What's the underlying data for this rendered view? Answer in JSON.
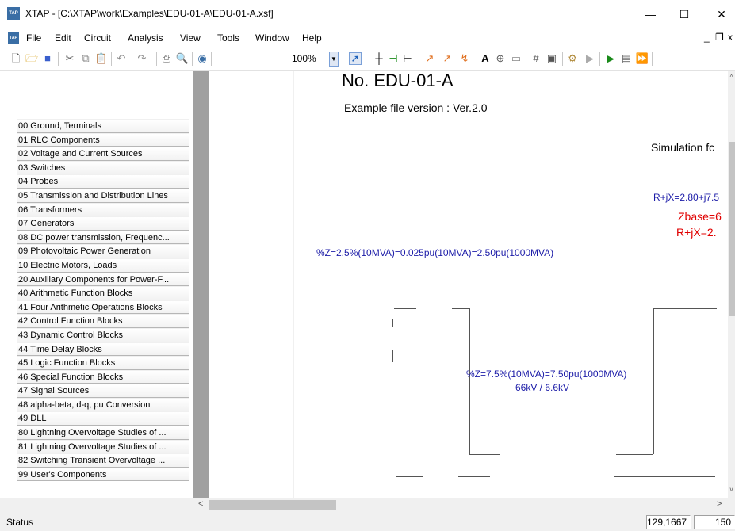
{
  "window": {
    "app_icon_text": "TAP",
    "title": "XTAP - [C:\\XTAP\\work\\Examples\\EDU-01-A\\EDU-01-A.xsf]",
    "minimize": "—",
    "maximize": "☐",
    "close": "✕"
  },
  "menubar": {
    "items": [
      "File",
      "Edit",
      "Circuit",
      "Analysis",
      "View",
      "Tools",
      "Window",
      "Help"
    ],
    "doc_min": "_",
    "doc_restore": "❐",
    "doc_close": "x"
  },
  "toolbar": {
    "zoom_value": "100%",
    "zoom_dropdown": "▼",
    "icons": [
      "new-file-icon",
      "open-folder-icon",
      "save-icon",
      "cut-icon",
      "copy-icon",
      "paste-icon",
      "undo-icon",
      "redo-icon",
      "print-icon",
      "print-preview-icon",
      "globe-icon",
      "pointer-icon",
      "wire-icon",
      "component-icon",
      "node-icon",
      "probe-icon",
      "arrow-icon",
      "junction-icon",
      "text-icon",
      "zoom-icon",
      "frame-icon",
      "grid-icon",
      "properties-icon",
      "settings-icon",
      "run-icon",
      "export-icon",
      "table-icon",
      "forward-icon"
    ],
    "text_tool": "A"
  },
  "components": [
    "00 Ground, Terminals",
    "01 RLC Components",
    "02 Voltage and Current Sources",
    "03 Switches",
    "04 Probes",
    "05 Transmission and Distribution Lines",
    "06 Transformers",
    "07 Generators",
    "08 DC power transmission, Frequenc...",
    "09 Photovoltaic Power Generation",
    "10 Electric Motors, Loads",
    "20 Auxiliary Components for Power-F...",
    "40 Arithmetic Function Blocks",
    "41 Four Arithmetic Operations Blocks",
    "42 Control Function Blocks",
    "43 Dynamic Control Blocks",
    "44 Time Delay Blocks",
    "45 Logic Function Blocks",
    "46 Special Function Blocks",
    "47 Signal Sources",
    "48 alpha-beta, d-q, pu Conversion",
    "49 DLL",
    "80 Lightning Overvoltage Studies of ...",
    "81 Lightning Overvoltage Studies of ...",
    "82 Switching Transient Overvoltage ...",
    "99 User's Components"
  ],
  "canvas": {
    "doc_title": "No. EDU-01-A",
    "version": "Example file version : Ver.2.0",
    "simulation": "Simulation fc",
    "rjx_blue": "R+jX=2.80+j7.5",
    "zbase": "Zbase=6",
    "rjx_red": "R+jX=2.",
    "z_line": "%Z=2.5%(10MVA)=0.025pu(10MVA)=2.50pu(1000MVA)",
    "z_tr": "%Z=7.5%(10MVA)=7.50pu(1000MVA)",
    "tr_ratio": "66kV / 6.6kV"
  },
  "scroll": {
    "left_arrow": "<",
    "right_arrow": ">",
    "up_arrow": "^",
    "down_arrow": "v"
  },
  "status": {
    "label": "Status",
    "coords": "129,1667",
    "extra": "150"
  }
}
